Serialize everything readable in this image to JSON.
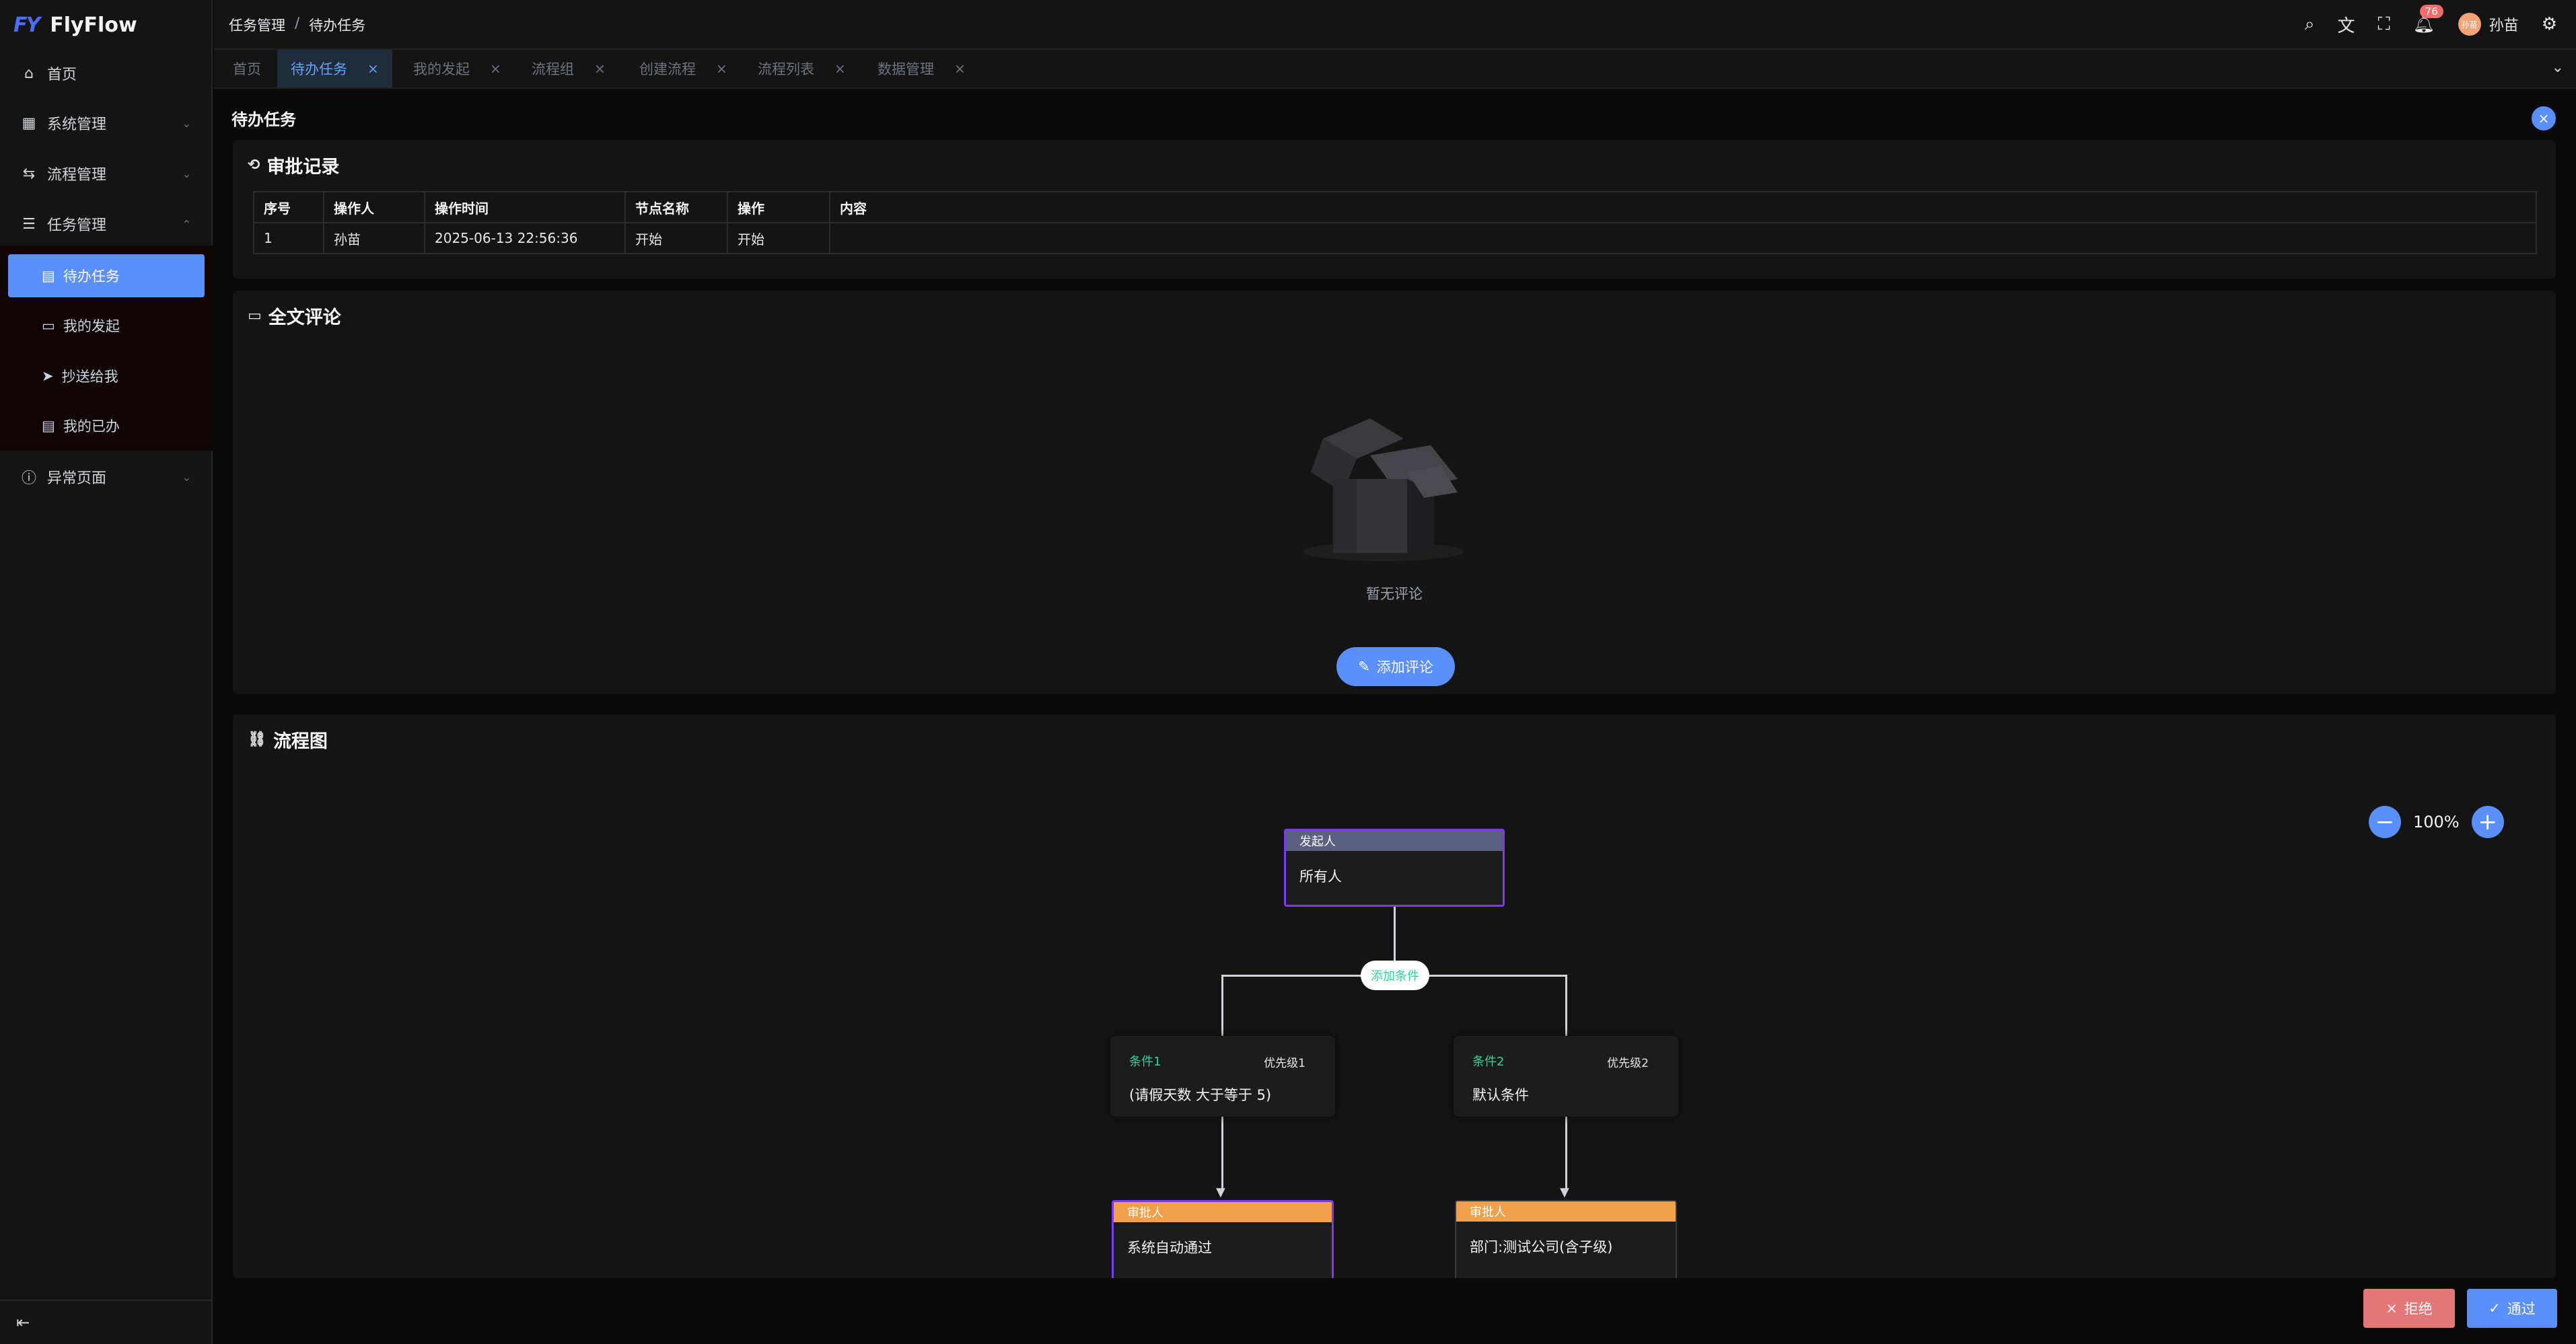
{
  "app": {
    "name": "FlyFlow",
    "logo_mark": "FY"
  },
  "sidebar": {
    "items": [
      {
        "label": "首页",
        "icon": "home-icon",
        "glyph": "⌂"
      },
      {
        "label": "系统管理",
        "icon": "grid-icon",
        "glyph": "▦"
      },
      {
        "label": "流程管理",
        "icon": "flow-icon",
        "glyph": "⇆"
      },
      {
        "label": "任务管理",
        "icon": "list-icon",
        "glyph": "☰"
      },
      {
        "label": "异常页面",
        "icon": "info-icon",
        "glyph": "ⓘ"
      }
    ],
    "sub_items": [
      {
        "label": "待办任务",
        "glyph": "▤"
      },
      {
        "label": "我的发起",
        "glyph": "▭"
      },
      {
        "label": "抄送给我",
        "glyph": "➤"
      },
      {
        "label": "我的已办",
        "glyph": "▤"
      }
    ],
    "collapse_glyph": "⇤"
  },
  "header": {
    "breadcrumb": [
      "任务管理",
      "待办任务"
    ],
    "notification_count": "76",
    "user_name": "孙苗",
    "avatar_text": "孙苗"
  },
  "tabs": [
    {
      "label": "首页"
    },
    {
      "label": "待办任务"
    },
    {
      "label": "我的发起"
    },
    {
      "label": "流程组"
    },
    {
      "label": "创建流程"
    },
    {
      "label": "流程列表"
    },
    {
      "label": "数据管理"
    }
  ],
  "page": {
    "title": "待办任务"
  },
  "approval": {
    "title": "审批记录",
    "columns": [
      "序号",
      "操作人",
      "操作时间",
      "节点名称",
      "操作",
      "内容"
    ],
    "rows": [
      [
        "1",
        "孙苗",
        "2025-06-13 22:56:36",
        "开始",
        "开始",
        ""
      ]
    ]
  },
  "comments": {
    "title": "全文评论",
    "empty_text": "暂无评论",
    "add_button": "添加评论"
  },
  "flow": {
    "title": "流程图",
    "zoom": "100%",
    "initiator": {
      "head": "发起人",
      "body": "所有人"
    },
    "add_condition": "添加条件",
    "conditions": [
      {
        "name": "条件1",
        "priority": "优先级1",
        "text": "(请假天数 大于等于 5)"
      },
      {
        "name": "条件2",
        "priority": "优先级2",
        "text": "默认条件"
      }
    ],
    "approvers": [
      {
        "head": "审批人",
        "body": "系统自动通过"
      },
      {
        "head": "审批人",
        "body": "部门:测试公司(含子级)"
      }
    ]
  },
  "actions": {
    "reject": "拒绝",
    "pass": "通过"
  },
  "colors": {
    "accent": "#5b8ff9",
    "initiator_head": "#5b5f80",
    "approver_head": "#f0a04b",
    "node_border_purple": "#7c3aed",
    "condition_green": "#34d399",
    "reject": "#e47777"
  }
}
